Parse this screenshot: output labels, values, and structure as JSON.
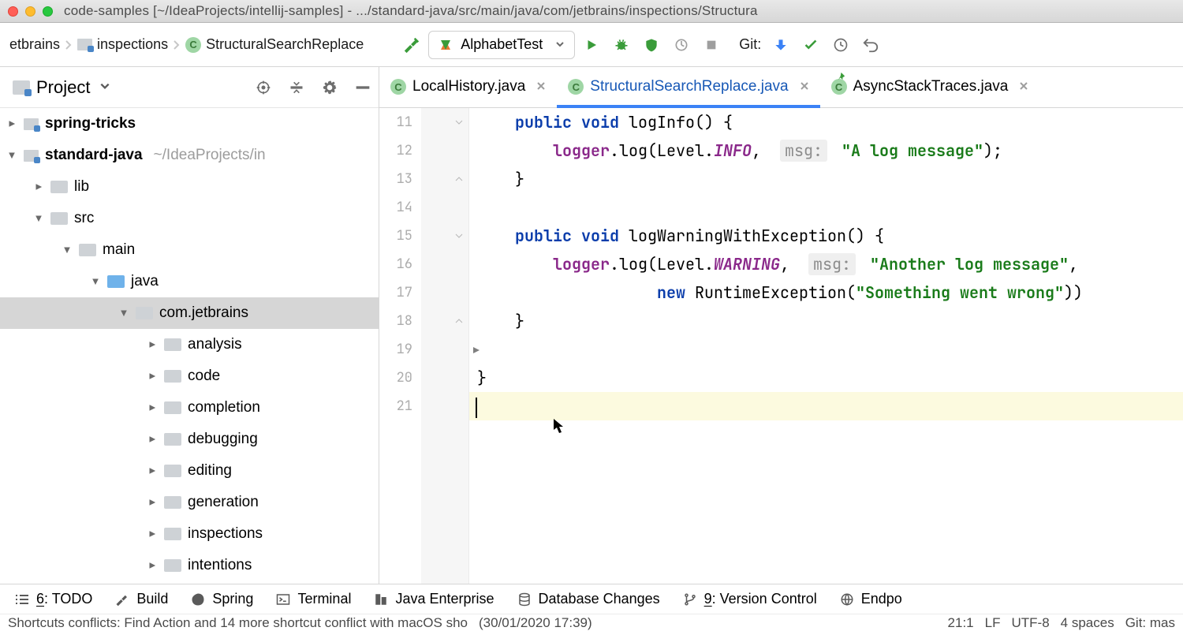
{
  "title": "code-samples [~/IdeaProjects/intellij-samples] - .../standard-java/src/main/java/com/jetbrains/inspections/Structura",
  "breadcrumbs": {
    "b1": "etbrains",
    "b2": "inspections",
    "b3": "StructuralSearchReplace"
  },
  "runConfig": "AlphabetTest",
  "gitLabel": "Git:",
  "projectTool": {
    "title": "Project"
  },
  "tree": {
    "n0": "spring-tricks",
    "n1": "standard-java",
    "n1p": "~/IdeaProjects/in",
    "n2": "lib",
    "n3": "src",
    "n4": "main",
    "n5": "java",
    "n6": "com.jetbrains",
    "n7": "analysis",
    "n8": "code",
    "n9": "completion",
    "n10": "debugging",
    "n11": "editing",
    "n12": "generation",
    "n13": "inspections",
    "n14": "intentions"
  },
  "tabs": {
    "t1": "LocalHistory.java",
    "t2": "StructuralSearchReplace.java",
    "t3": "AsyncStackTraces.java"
  },
  "gutter": {
    "l11": "11",
    "l12": "12",
    "l13": "13",
    "l14": "14",
    "l15": "15",
    "l16": "16",
    "l17": "17",
    "l18": "18",
    "l19": "19",
    "l20": "20",
    "l21": "21"
  },
  "code": {
    "kw_public": "public",
    "kw_void": "void",
    "kw_new": "new",
    "m1": "logInfo",
    "m2": "logWarningWithException",
    "logger": "logger",
    "log": ".log(Level.",
    "info": "INFO",
    "warn": "WARNING",
    "hint": "msg:",
    "s1": "\"A log message\"",
    "s2": "\"Another log message\"",
    "rt": "RuntimeException(",
    "s3": "\"Something went wrong\"",
    "comma": ",",
    "close": ");",
    "close2": "))",
    "lb": "() {",
    "rb": "}"
  },
  "bottom": {
    "todo": "6: TODO",
    "build": "Build",
    "spring": "Spring",
    "term": "Terminal",
    "jee": "Java Enterprise",
    "db": "Database Changes",
    "vcs": "9: Version Control",
    "endp": "Endpo"
  },
  "status": {
    "msg": "Shortcuts conflicts: Find Action   and 14 more shortcut conflict with macOS sho",
    "date": "(30/01/2020  17:39)",
    "pos": "21:1",
    "le": "LF",
    "enc": "UTF-8",
    "indent": "4 spaces",
    "branch": "Git: mas"
  }
}
